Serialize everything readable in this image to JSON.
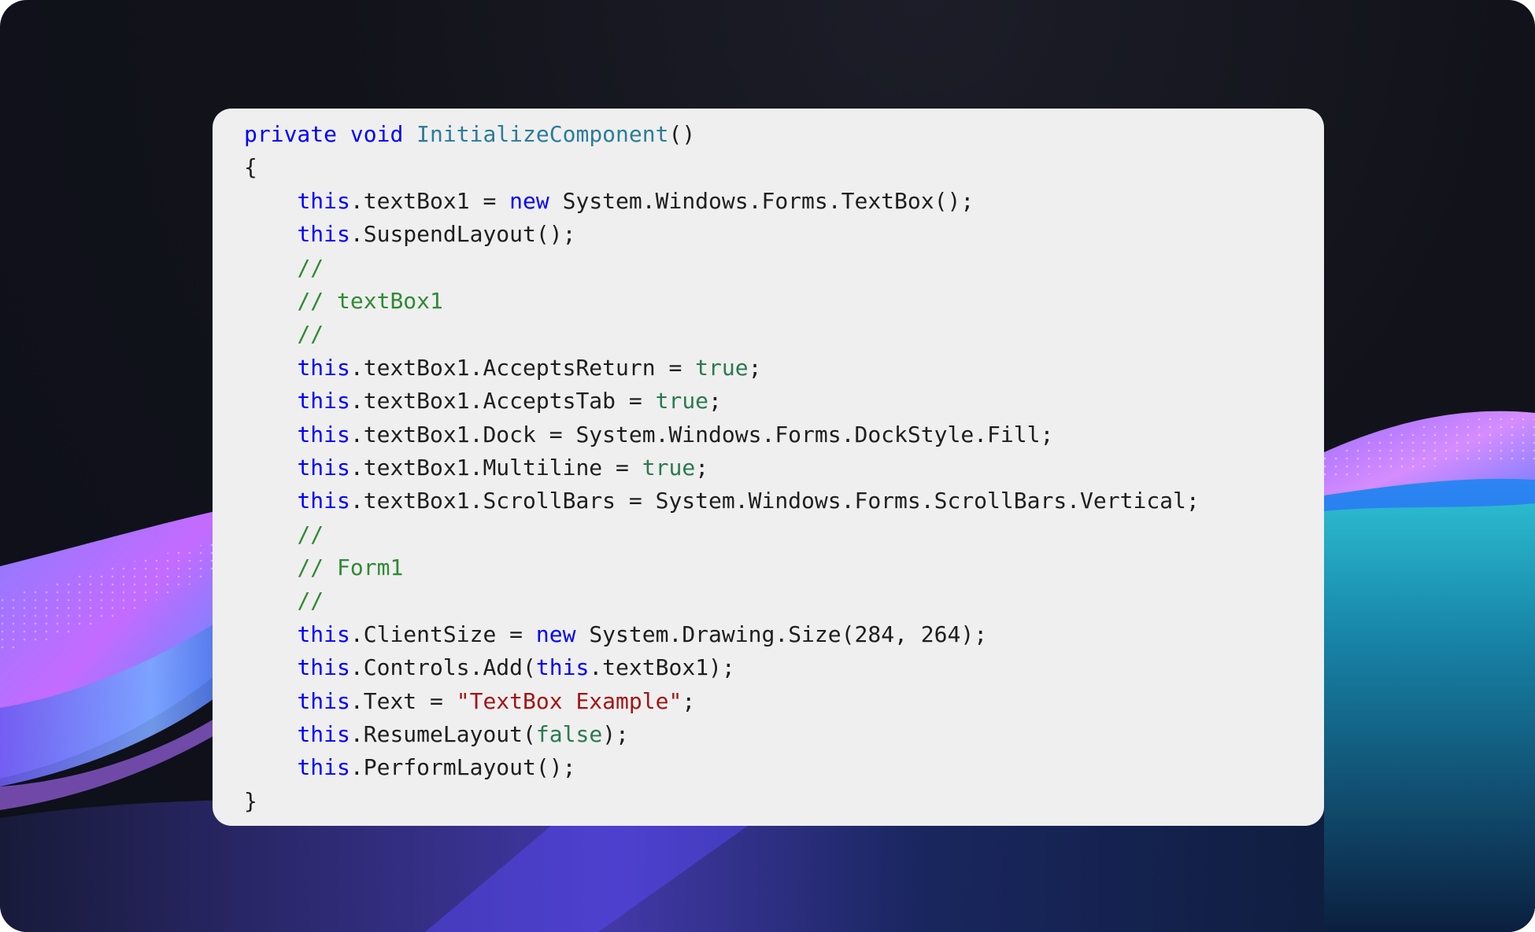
{
  "code_snippet": {
    "language": "C#",
    "lines": [
      "private void InitializeComponent()",
      "{",
      "    this.textBox1 = new System.Windows.Forms.TextBox();",
      "    this.SuspendLayout();",
      "    //",
      "    // textBox1",
      "    //",
      "    this.textBox1.AcceptsReturn = true;",
      "    this.textBox1.AcceptsTab = true;",
      "    this.textBox1.Dock = System.Windows.Forms.DockStyle.Fill;",
      "    this.textBox1.Multiline = true;",
      "    this.textBox1.ScrollBars = System.Windows.Forms.ScrollBars.Vertical;",
      "    //",
      "    // Form1",
      "    //",
      "    this.ClientSize = new System.Drawing.Size(284, 264);",
      "    this.Controls.Add(this.textBox1);",
      "    this.Text = \"TextBox Example\";",
      "    this.ResumeLayout(false);",
      "    this.PerformLayout();",
      "}"
    ]
  },
  "theme": {
    "panel_background": "#efefef",
    "keyword_color": "#0000ff",
    "method_name_color": "#2b7c9a",
    "literal_color": "#2a7a4e",
    "comment_color": "#2f8a33",
    "string_color": "#a31515",
    "text_color": "#1e1e1e"
  },
  "background": {
    "description_colors": [
      "#12131a",
      "#7b5cff",
      "#c46bff",
      "#2fc3d6",
      "#1a2a6b"
    ]
  }
}
